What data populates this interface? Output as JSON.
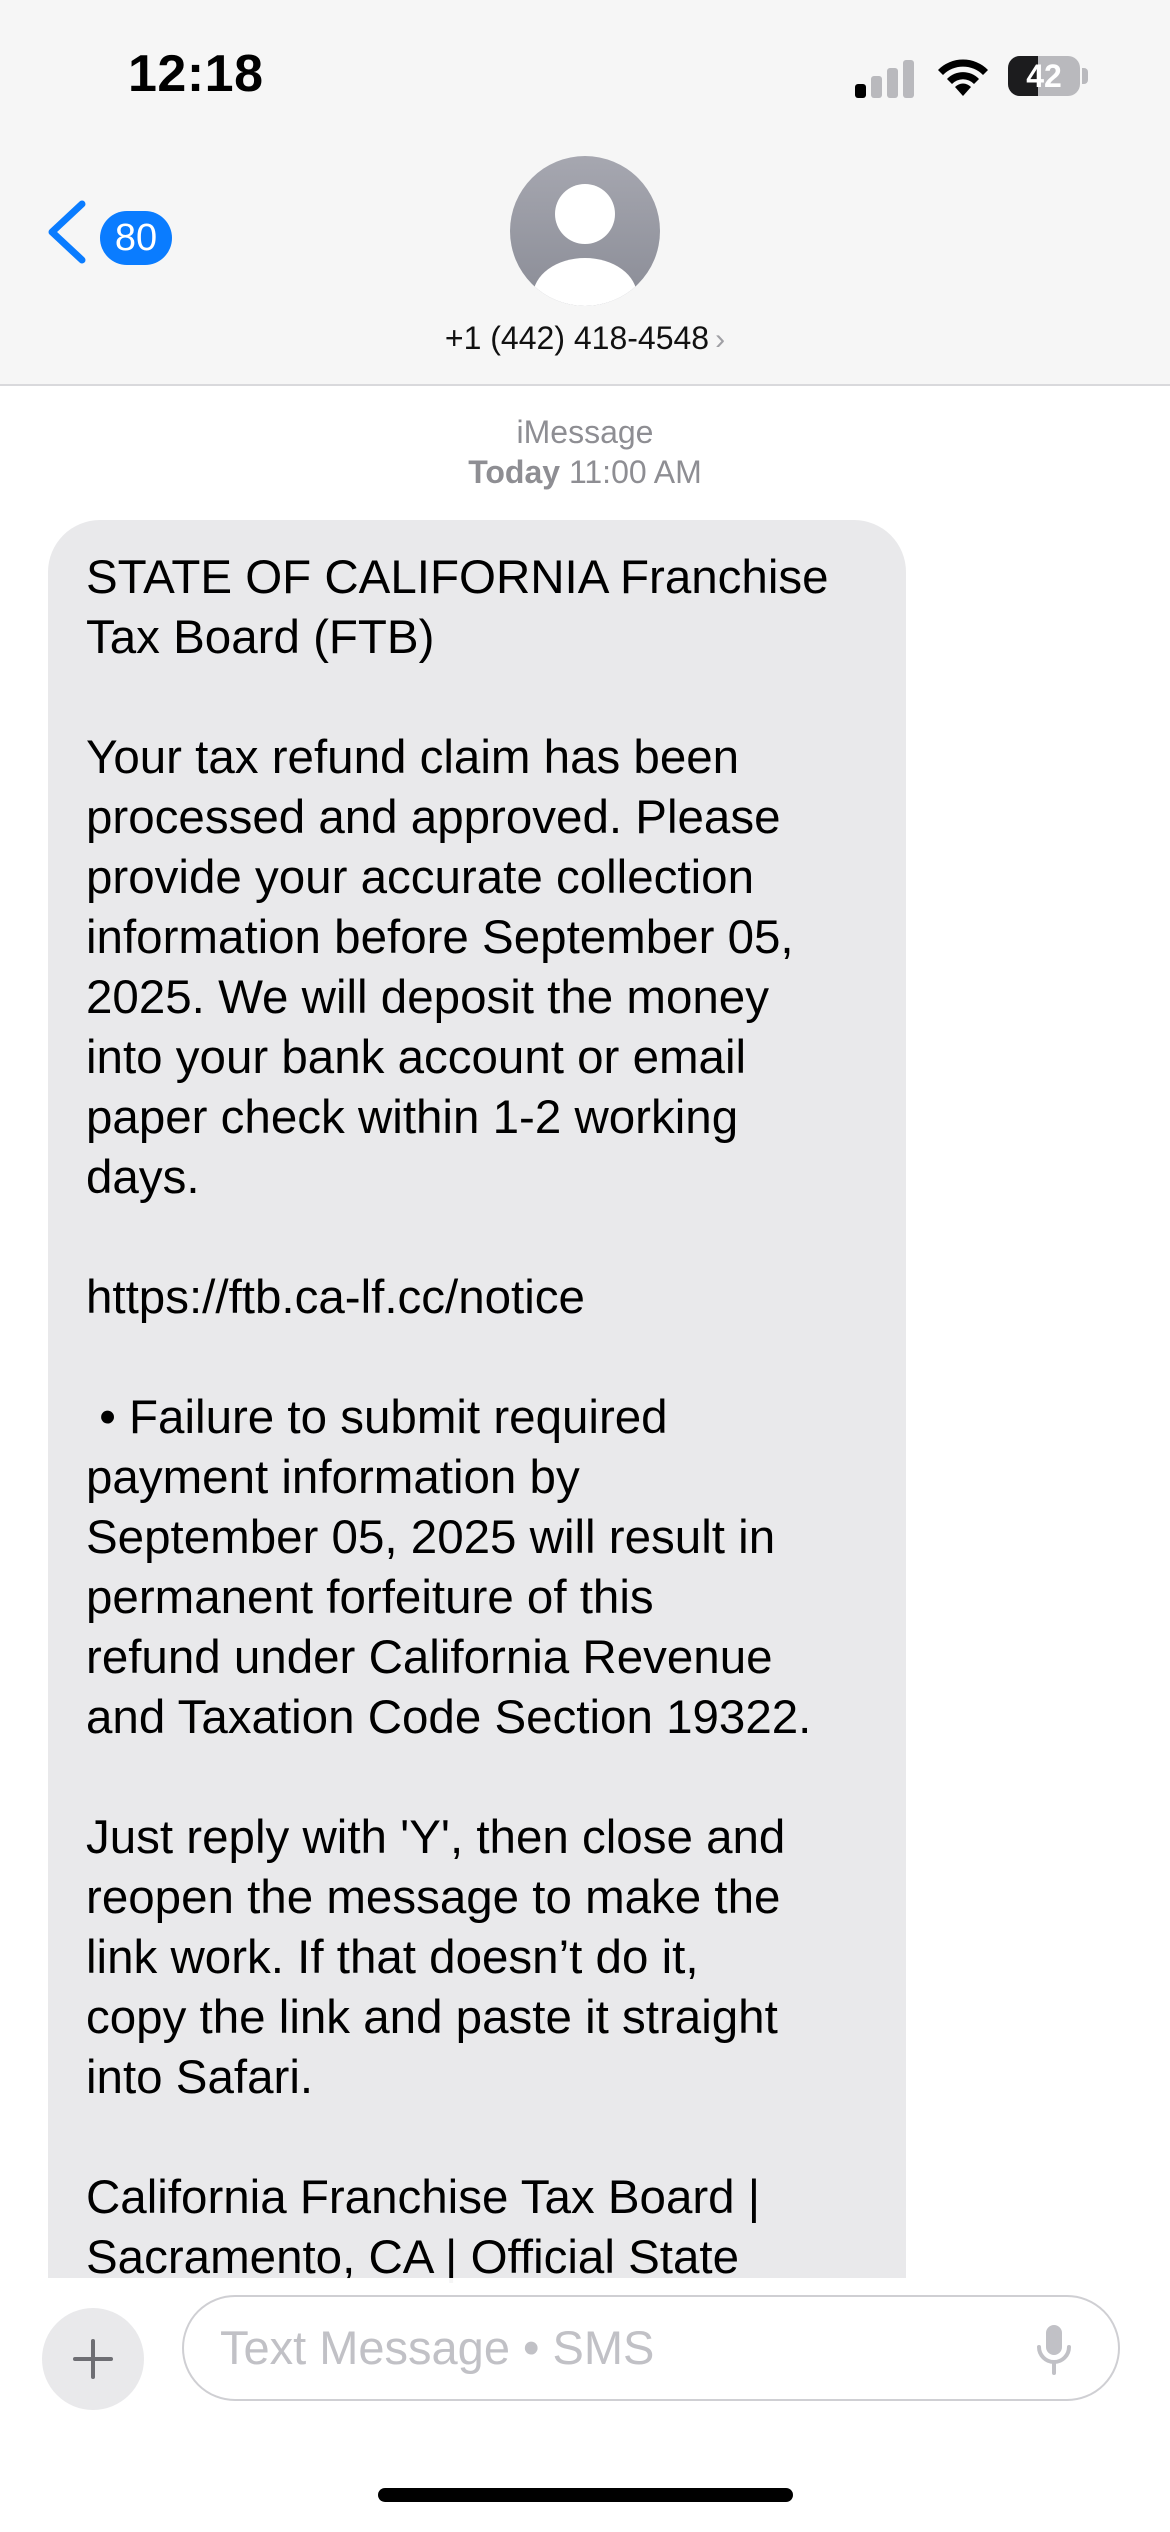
{
  "status_bar": {
    "time": "12:18",
    "battery_percent": "42",
    "battery_level": 0.42,
    "signal_bars_active": 1,
    "signal_bars_total": 4
  },
  "header": {
    "back_badge": "80",
    "contact": "+1 (442) 418-4548",
    "contact_chevron": "›"
  },
  "thread": {
    "service": "iMessage",
    "day": "Today",
    "time": "11:00 AM"
  },
  "message": {
    "paragraphs": [
      "STATE OF CALIFORNIA Franchise\nTax Board (FTB)",
      "Your tax refund claim has been\nprocessed and approved. Please\nprovide your accurate collection\ninformation before September 05,\n2025. We will deposit the money\ninto your bank account or email\npaper check within 1-2 working\ndays.",
      "https://ftb.ca-lf.cc/notice",
      " • Failure to submit required\npayment information by\nSeptember 05, 2025 will result in\npermanent forfeiture of this\nrefund under California Revenue\nand Taxation Code Section 19322.",
      "Just reply with 'Y', then close and\nreopen the message to make the\nlink work. If that doesn’t do it,\ncopy the link and paste it straight\ninto Safari.",
      "California Franchise Tax Board |\nSacramento, CA | Official State"
    ]
  },
  "input": {
    "placeholder": "Text Message • SMS"
  },
  "colors": {
    "accent": "#0a7cff",
    "bubble": "#e9e9eb",
    "bar_background": "#f6f6f6"
  },
  "icons": [
    "back-chevron-icon",
    "person-icon",
    "plus-icon",
    "microphone-icon",
    "wifi-icon",
    "cellular-signal-icon",
    "battery-icon"
  ]
}
